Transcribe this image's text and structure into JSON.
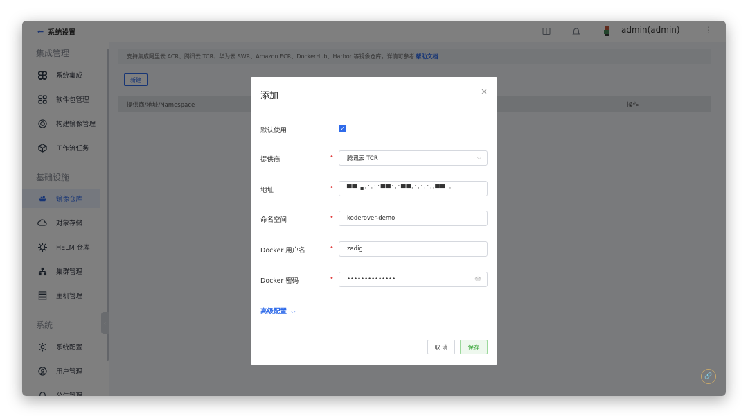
{
  "colors": {
    "accent": "#2f6bea",
    "required": "#e03c3c",
    "save": "#3aa63a"
  },
  "sidebar": {
    "back_label": "系统设置",
    "groups": [
      "集成管理",
      "基础设施",
      "系统"
    ],
    "items": [
      {
        "label": "系统集成",
        "icon": "command-icon"
      },
      {
        "label": "软件包管理",
        "icon": "grid-icon"
      },
      {
        "label": "构建镜像管理",
        "icon": "target-icon"
      },
      {
        "label": "工作流任务",
        "icon": "cube-icon"
      },
      {
        "label": "镜像仓库",
        "icon": "ship-icon",
        "active": true
      },
      {
        "label": "对象存储",
        "icon": "cloud-icon"
      },
      {
        "label": "HELM 仓库",
        "icon": "helm-icon"
      },
      {
        "label": "集群管理",
        "icon": "cluster-icon"
      },
      {
        "label": "主机管理",
        "icon": "server-icon"
      },
      {
        "label": "系统配置",
        "icon": "settings-icon"
      },
      {
        "label": "用户管理",
        "icon": "user-circle-icon"
      },
      {
        "label": "公告管理",
        "icon": "bell-icon"
      }
    ]
  },
  "header": {
    "user": "admin(admin)"
  },
  "main": {
    "notice": "支持集成阿里云 ACR、腾讯云 TCR、华为云 SWR、Amazon ECR、DockerHub、Harbor 等镜像仓库，详情可参考",
    "notice_link": "帮助文档",
    "new_button": "新建",
    "columns": [
      "提供商/地址/Namespace",
      "操作"
    ]
  },
  "modal": {
    "title": "添加",
    "fields": {
      "default_label": "默认使用",
      "provider_label": "提供商",
      "provider_value": "腾讯云 TCR",
      "address_label": "地址",
      "address_value": "▀▀ ▪·˙·˙˙▀▀˙·˙▀▀·˙·˙·˙··▀▀˙·",
      "namespace_label": "命名空间",
      "namespace_value": "koderover-demo",
      "user_label": "Docker 用户名",
      "user_value": "zadig",
      "password_label": "Docker 密码",
      "password_value": "••••••••••••••"
    },
    "advanced": "高级配置",
    "cancel": "取 消",
    "save": "保存"
  }
}
